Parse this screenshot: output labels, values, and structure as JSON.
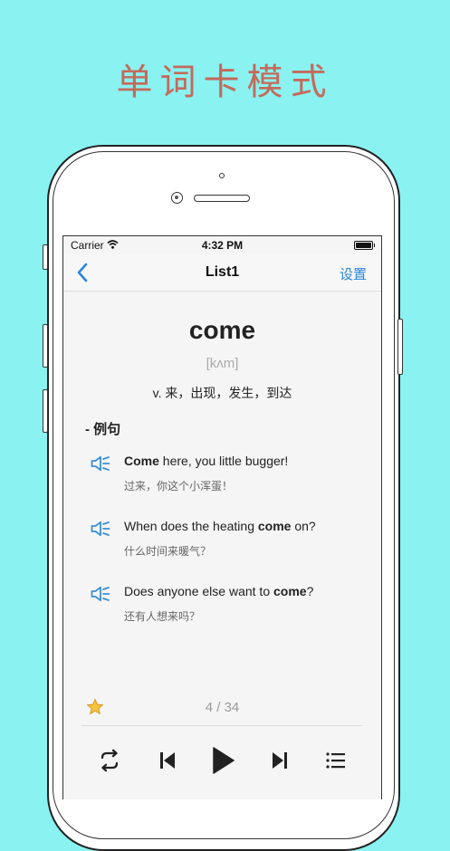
{
  "headline": "单词卡模式",
  "status_bar": {
    "carrier": "Carrier",
    "time": "4:32 PM"
  },
  "nav": {
    "title": "List1",
    "settings_label": "设置"
  },
  "card": {
    "word": "come",
    "phonetic": "[kʌm]",
    "meaning": "v. 来，出现，发生，到达",
    "section_title": "- 例句",
    "examples": [
      {
        "en_before": "",
        "en_keyword": "Come",
        "en_after": " here, you little bugger!",
        "zh": "过来，你这个小浑蛋！"
      },
      {
        "en_before": "When does the heating ",
        "en_keyword": "come",
        "en_after": " on?",
        "zh": "什么时间来暖气？"
      },
      {
        "en_before": "Does anyone else want to ",
        "en_keyword": "come",
        "en_after": "?",
        "zh": "还有人想来吗？"
      }
    ]
  },
  "footer": {
    "counter": "4 / 34"
  },
  "icons": {
    "back": "chevron-left-icon",
    "speaker": "speaker-icon",
    "favorite": "star-icon",
    "loop": "repeat-icon",
    "previous": "skip-previous-icon",
    "play": "play-icon",
    "next": "skip-next-icon",
    "list": "list-icon"
  },
  "colors": {
    "background": "#8af2f0",
    "headline": "#c46a5b",
    "accent": "#2a86d8",
    "speaker_icon": "#3a8fd6",
    "star": "#f5c242"
  }
}
